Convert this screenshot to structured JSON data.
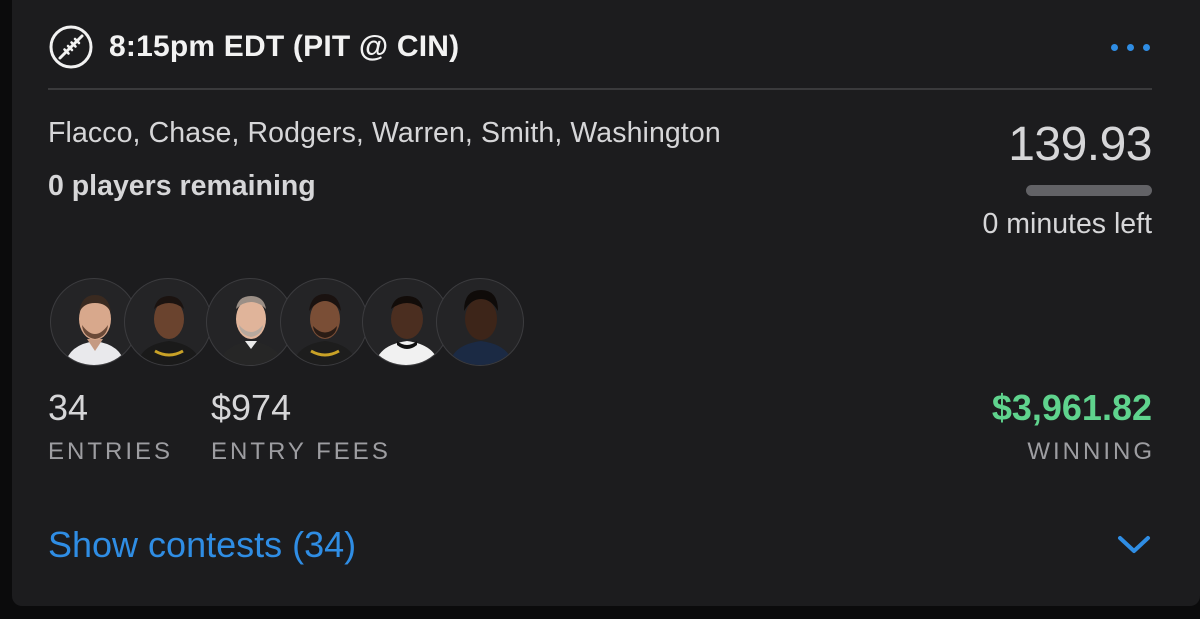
{
  "header": {
    "icon": "football-icon",
    "title": "8:15pm EDT (PIT @ CIN)",
    "more_icon": "ellipsis-icon"
  },
  "lineup": {
    "players": "Flacco, Chase, Rodgers, Warren, Smith, Washington",
    "remaining": "0 players remaining"
  },
  "score": {
    "points": "139.93",
    "progress_fraction": 0,
    "time_left": "0 minutes left"
  },
  "avatars": [
    {
      "name": "player-headshot-1"
    },
    {
      "name": "player-headshot-2"
    },
    {
      "name": "player-headshot-3"
    },
    {
      "name": "player-headshot-4"
    },
    {
      "name": "player-headshot-5"
    },
    {
      "name": "player-headshot-6"
    }
  ],
  "stats": {
    "entries_value": "34",
    "entries_label": "ENTRIES",
    "fees_value": "$974",
    "fees_label": "ENTRY FEES",
    "winning_value": "$3,961.82",
    "winning_label": "WINNING"
  },
  "footer": {
    "show_contests": "Show contests (34)",
    "chevron_icon": "chevron-down-icon"
  },
  "colors": {
    "background": "#1c1c1e",
    "accent": "#2f8de4",
    "winning": "#5fd38d",
    "text": "#d6d6d8",
    "muted": "#9d9da1"
  }
}
